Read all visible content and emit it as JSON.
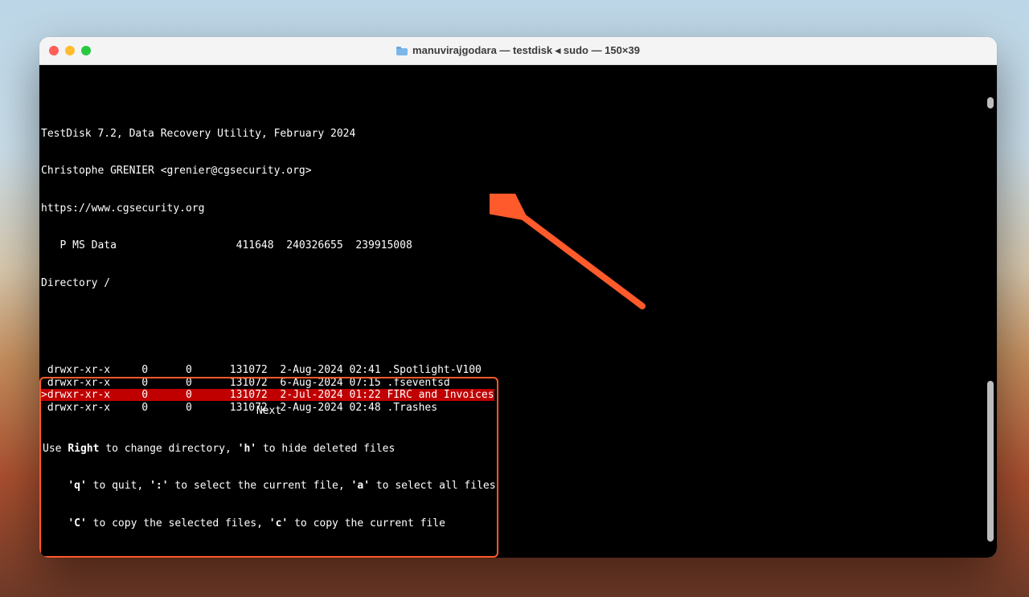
{
  "window": {
    "title": "manuvirajgodara — testdisk ◂ sudo — 150×39"
  },
  "header": {
    "line1": "TestDisk 7.2, Data Recovery Utility, February 2024",
    "line2": "Christophe GRENIER <grenier@cgsecurity.org>",
    "line3": "https://www.cgsecurity.org",
    "partition": "   P MS Data                   411648  240326655  239915008",
    "directory": "Directory /"
  },
  "files": [
    {
      "perm": " drwxr-xr-x",
      "uid": "0",
      "gid": "0",
      "size": "131072",
      "date": "2-Aug-2024 02:41",
      "name": ".Spotlight-V100",
      "selected": false
    },
    {
      "perm": " drwxr-xr-x",
      "uid": "0",
      "gid": "0",
      "size": "131072",
      "date": "6-Aug-2024 07:15",
      "name": ".fseventsd",
      "selected": false
    },
    {
      "perm": ">drwxr-xr-x",
      "uid": "0",
      "gid": "0",
      "size": "131072",
      "date": "2-Jul-2024 01:22",
      "name": "FIRC and Invoices",
      "selected": true
    },
    {
      "perm": " drwxr-xr-x",
      "uid": "0",
      "gid": "0",
      "size": "131072",
      "date": "2-Aug-2024 02:48",
      "name": ".Trashes",
      "selected": false
    }
  ],
  "footer": {
    "next": "Next",
    "l1a": "Use ",
    "l1b": "Right",
    "l1c": " to change directory, ",
    "l1d": "'h'",
    "l1e": " to hide deleted files",
    "l2a": "    ",
    "l2b": "'q'",
    "l2c": " to quit, ",
    "l2d": "':'",
    "l2e": " to select the current file, ",
    "l2f": "'a'",
    "l2g": " to select all files",
    "l3a": "    ",
    "l3b": "'C'",
    "l3c": " to copy the selected files, ",
    "l3d": "'c'",
    "l3e": " to copy the current file"
  },
  "annotation": {
    "arrow_color": "#ff5a2b"
  }
}
